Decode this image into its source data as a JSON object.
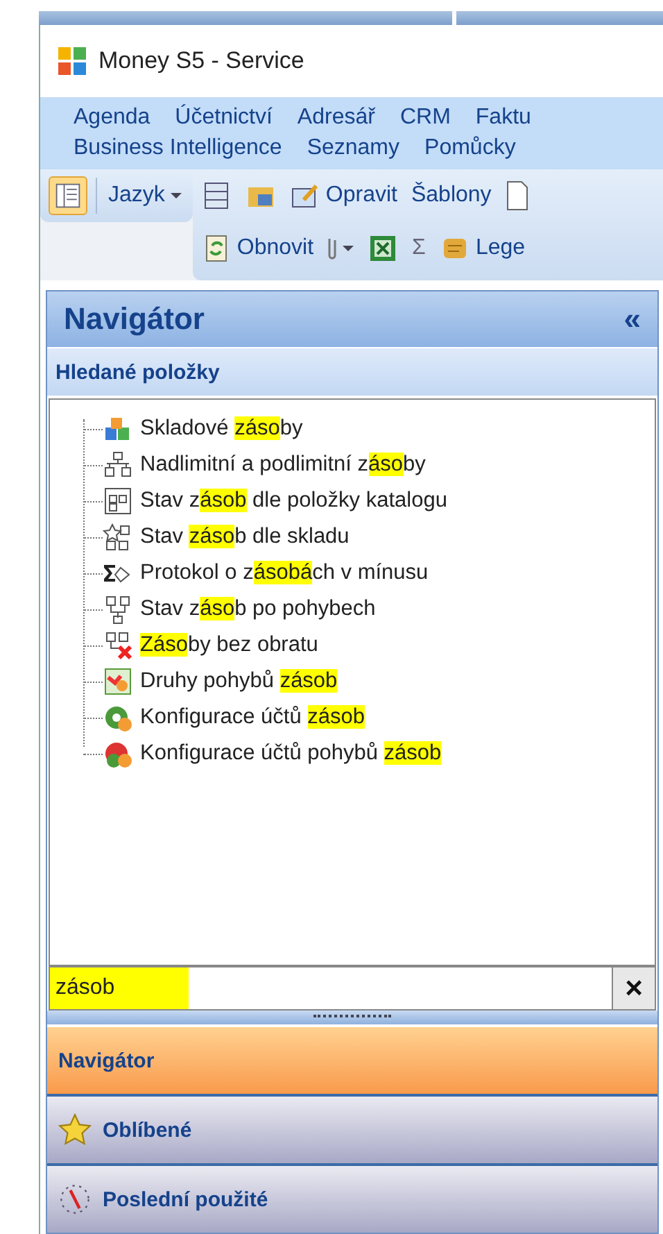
{
  "window": {
    "title": "Money S5 - Service"
  },
  "menu": {
    "items": [
      {
        "label": "Agenda"
      },
      {
        "label": "Účetnictví"
      },
      {
        "label": "Adresář"
      },
      {
        "label": "CRM"
      },
      {
        "label": "Faktu"
      },
      {
        "label": "Business Intelligence"
      },
      {
        "label": "Seznamy"
      },
      {
        "label": "Pomůcky"
      }
    ]
  },
  "toolbar": {
    "navigator_toggle": {
      "selected": true
    },
    "language": {
      "label": "Jazyk"
    },
    "edit": {
      "label": "Opravit"
    },
    "templates": {
      "label": "Šablony"
    },
    "refresh": {
      "label": "Obnovit"
    },
    "sum": {
      "label": "Σ"
    },
    "legend": {
      "label": "Lege"
    }
  },
  "navigator": {
    "title": "Navigátor",
    "collapse": "«",
    "section": "Hledané položky",
    "items": [
      {
        "parts": [
          {
            "text": "Skladové ",
            "highlighted": false
          },
          {
            "text": "záso",
            "highlighted": true
          },
          {
            "text": "by",
            "highlighted": false
          }
        ]
      },
      {
        "parts": [
          {
            "text": "Nadlimitní a podlimitní z",
            "highlighted": false
          },
          {
            "text": "áso",
            "highlighted": true
          },
          {
            "text": "by",
            "highlighted": false
          }
        ]
      },
      {
        "parts": [
          {
            "text": "Stav z",
            "highlighted": false
          },
          {
            "text": "ásob",
            "highlighted": true
          },
          {
            "text": " dle položky katalogu",
            "highlighted": false
          }
        ]
      },
      {
        "parts": [
          {
            "text": "Stav ",
            "highlighted": false
          },
          {
            "text": "záso",
            "highlighted": true
          },
          {
            "text": "b dle skladu",
            "highlighted": false
          }
        ]
      },
      {
        "parts": [
          {
            "text": "Protokol o z",
            "highlighted": false
          },
          {
            "text": "ásobá",
            "highlighted": true
          },
          {
            "text": "ch v mínusu",
            "highlighted": false
          }
        ]
      },
      {
        "parts": [
          {
            "text": "Stav z",
            "highlighted": false
          },
          {
            "text": "áso",
            "highlighted": true
          },
          {
            "text": "b po pohybech",
            "highlighted": false
          }
        ]
      },
      {
        "parts": [
          {
            "text": "Záso",
            "highlighted": true
          },
          {
            "text": "by bez obratu",
            "highlighted": false
          }
        ]
      },
      {
        "parts": [
          {
            "text": "Druhy pohybů ",
            "highlighted": false
          },
          {
            "text": "zásob",
            "highlighted": true
          }
        ]
      },
      {
        "parts": [
          {
            "text": "Konfigurace účtů ",
            "highlighted": false
          },
          {
            "text": "zásob",
            "highlighted": true
          }
        ]
      },
      {
        "parts": [
          {
            "text": "Konfigurace účtů pohybů ",
            "highlighted": false
          },
          {
            "text": "zásob",
            "highlighted": true
          }
        ]
      }
    ],
    "search": {
      "value": "zásob",
      "highlighted": true,
      "clear": "×"
    }
  },
  "panels": [
    {
      "label": "Navigátor",
      "selected": true
    },
    {
      "label": "Oblíbené",
      "selected": false
    },
    {
      "label": "Poslední použité",
      "selected": false
    }
  ]
}
